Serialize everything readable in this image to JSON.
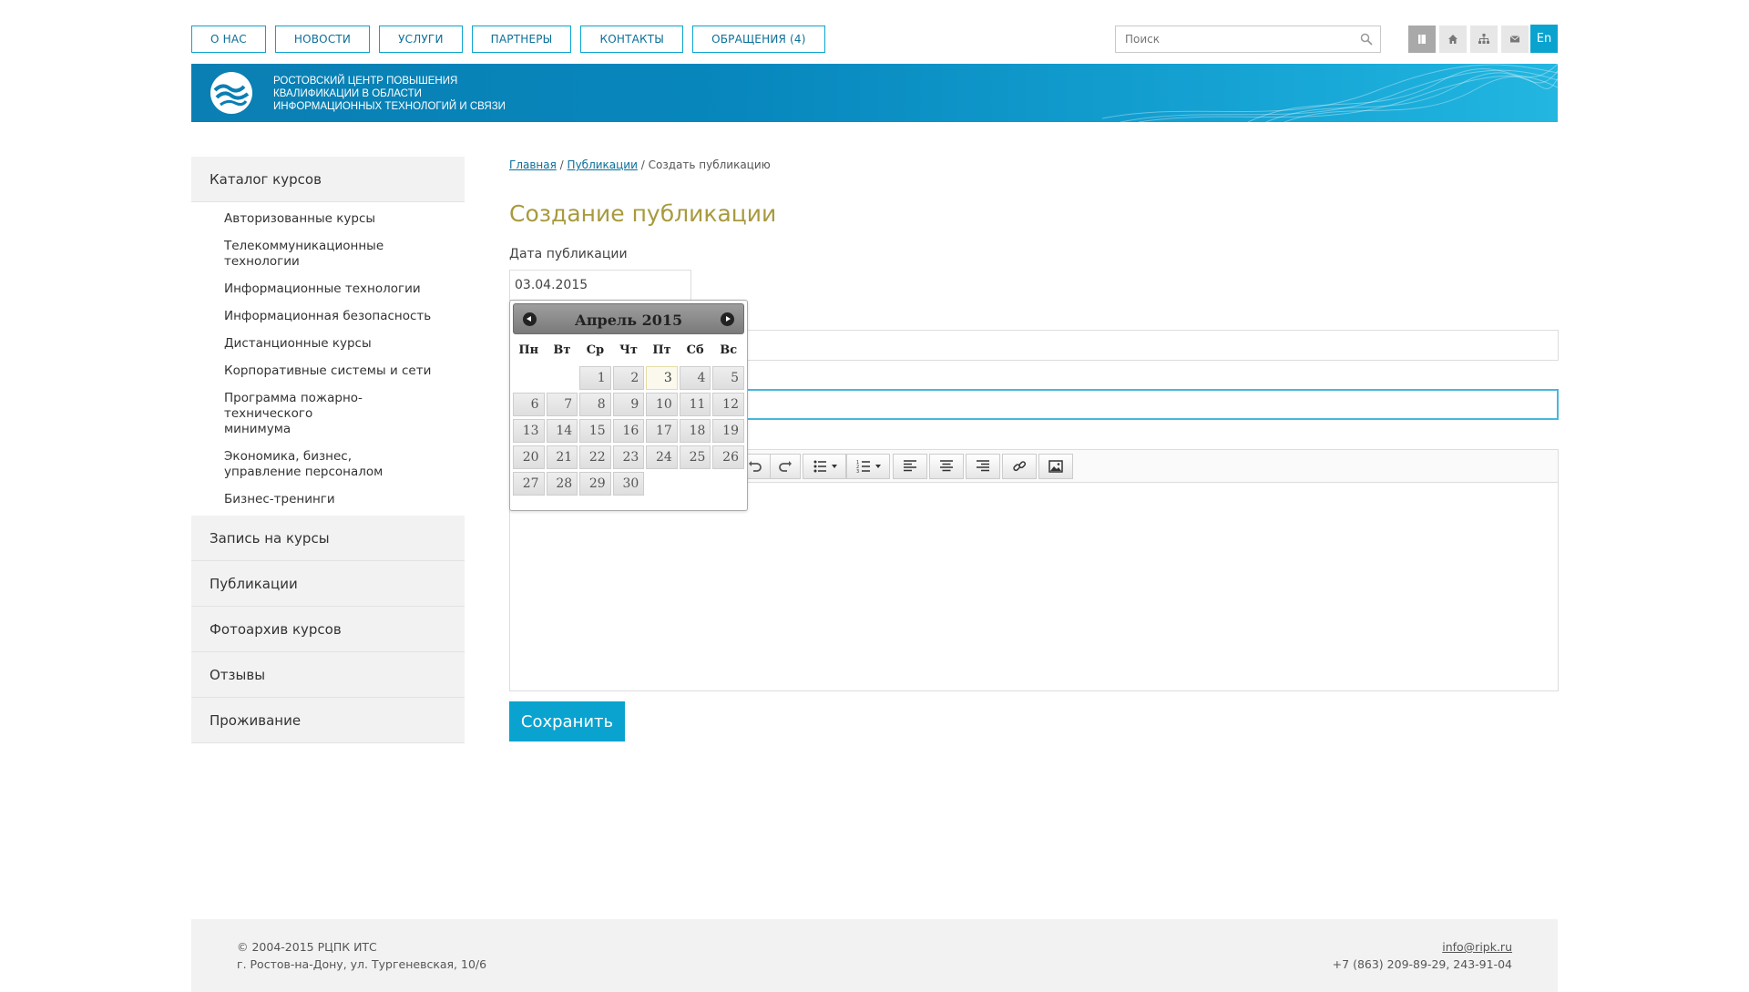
{
  "topnav": [
    "О НАС",
    "НОВОСТИ",
    "УСЛУГИ",
    "ПАРТНЕРЫ",
    "КОНТАКТЫ",
    "ОБРАЩЕНИЯ (4)"
  ],
  "search": {
    "placeholder": "Поиск"
  },
  "icons": [
    "book-icon",
    "home-icon",
    "sitemap-icon",
    "mail-icon"
  ],
  "lang": "En",
  "banner": {
    "title_lines": [
      "РОСТОВСКИЙ ЦЕНТР ПОВЫШЕНИЯ",
      "КВАЛИФИКАЦИИ В ОБЛАСТИ",
      "ИНФОРМАЦИОННЫХ ТЕХНОЛОГИЙ И СВЯЗИ"
    ]
  },
  "sidebar": {
    "catalog": "Каталог курсов",
    "sub_items": [
      "Авторизованные курсы",
      "Телекоммуникационные технологии",
      "Информационные технологии",
      "Информационная безопасность",
      "Дистанционные курсы",
      "Корпоративные системы и сети",
      "Программа пожарно-технического минимума",
      "Экономика, бизнес, управление персоналом",
      "Бизнес-тренинги"
    ],
    "sections": [
      "Запись на курсы",
      "Публикации",
      "Фотоархив курсов",
      "Отзывы",
      "Проживание"
    ]
  },
  "breadcrumb": {
    "home": "Главная",
    "sep": "/",
    "pubs": "Публикации",
    "current": "Создать публикацию"
  },
  "page_title": "Создание публикации",
  "form": {
    "date_label": "Дата публикации",
    "date_value": "03.04.2015",
    "save": "Сохранить"
  },
  "datepicker": {
    "title": "Апрель 2015",
    "weekdays": [
      "Пн",
      "Вт",
      "Ср",
      "Чт",
      "Пт",
      "Сб",
      "Вс"
    ],
    "leading_blanks": 2,
    "days": 30,
    "today": 3
  },
  "footer": {
    "copyright": "© 2004-2015 РЦПК ИТС",
    "address": "г. Ростов-на-Дону, ул. Тургеневская, 10/6",
    "email": "info@ripk.ru",
    "phone": "+7 (863) 209-89-29, 243-91-04"
  }
}
